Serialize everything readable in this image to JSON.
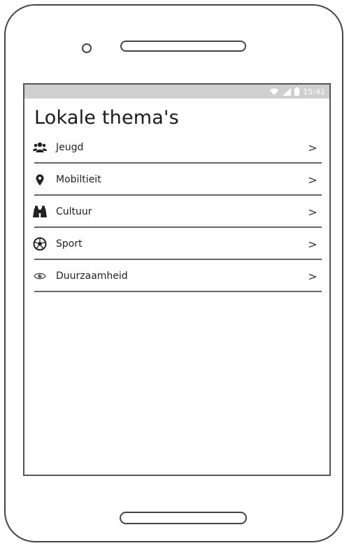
{
  "status_bar": {
    "time": "15:41",
    "icons": [
      "wifi-icon",
      "signal-icon",
      "battery-icon"
    ]
  },
  "page_title": "Lokale thema's",
  "themes": [
    {
      "label": "Jeugd",
      "icon": "users-icon",
      "chevron": ">"
    },
    {
      "label": "Mobiltieit",
      "icon": "map-marker-icon",
      "chevron": ">"
    },
    {
      "label": "Cultuur",
      "icon": "binoculars-icon",
      "chevron": ">"
    },
    {
      "label": "Sport",
      "icon": "soccer-ball-icon",
      "chevron": ">"
    },
    {
      "label": "Duurzaamheid",
      "icon": "eye-icon",
      "chevron": ">"
    }
  ]
}
